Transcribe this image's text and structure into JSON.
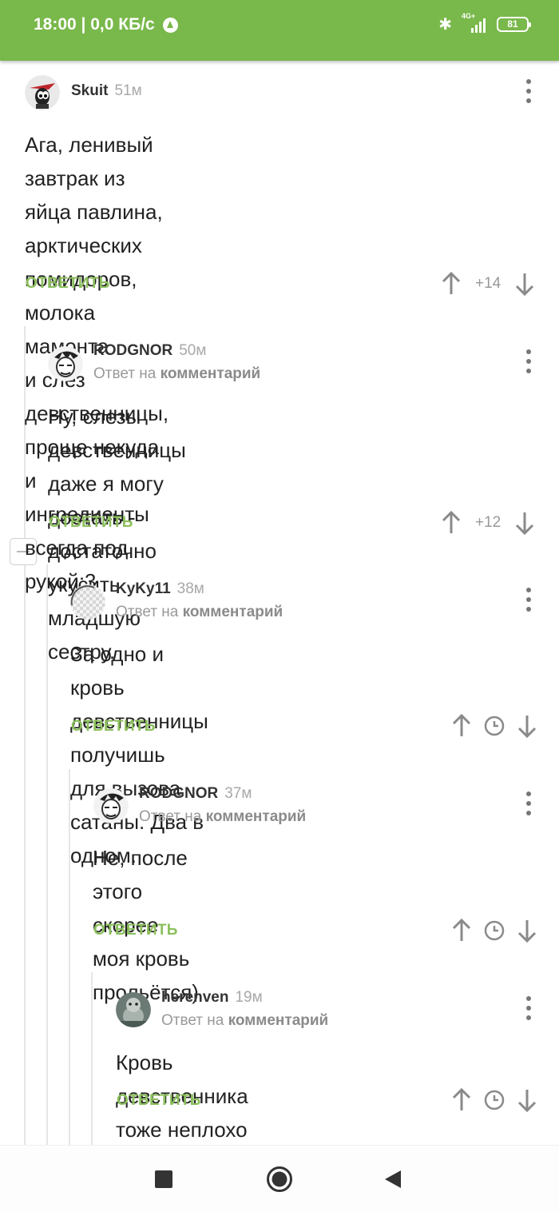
{
  "status_bar": {
    "time_and_speed": "18:00 | 0,0 КБ/с",
    "network": "4G+",
    "battery": "81"
  },
  "icons": {
    "upvote": "arrow-up-icon",
    "downvote": "arrow-down-icon",
    "menu": "more-vertical-icon",
    "pending": "clock-icon",
    "collapse": "minus-icon",
    "accent_color": "#79b84a",
    "reply_color": "#8bbf5c"
  },
  "comments": [
    {
      "user": "Skuit",
      "time": "51м",
      "text_lines": [
        "Ага, ленивый завтрак из яйца павлина,",
        "арктических помидоров, молока мамонта",
        "и слез девственницы, проще некуда и",
        "ингредиенты всегда под рукой:3"
      ],
      "reply_label": "ОТВЕТИТЬ",
      "rating": "+14"
    },
    {
      "user": "RODGNOR",
      "time": "50м",
      "reply_prefix": "Ответ на",
      "reply_target": "комментарий",
      "text_lines": [
        "Ну, слезы девственницы даже я могу",
        "достать - достаточно укусить младшую",
        "сестру."
      ],
      "reply_label": "ОТВЕТИТЬ",
      "rating": "+12"
    },
    {
      "user": "KyKy11",
      "time": "38м",
      "reply_prefix": "Ответ на",
      "reply_target": "комментарий",
      "text_lines": [
        "За одно и кровь девственницы получишь",
        "для вызова сатаны. Два в одном."
      ],
      "reply_label": "ОТВЕТИТЬ"
    },
    {
      "user": "RODGNOR",
      "time": "37м",
      "reply_prefix": "Ответ на",
      "reply_target": "комментарий",
      "text_lines": [
        "Не, после этого скорее моя кровь",
        "прольётся)"
      ],
      "reply_label": "ОТВЕТИТЬ"
    },
    {
      "user": "herenven",
      "time": "19м",
      "reply_prefix": "Ответ на",
      "reply_target": "комментарий",
      "text_lines": [
        "Кровь девственника тоже неплохо"
      ],
      "reply_label": "ОТВЕТИТЬ"
    }
  ]
}
